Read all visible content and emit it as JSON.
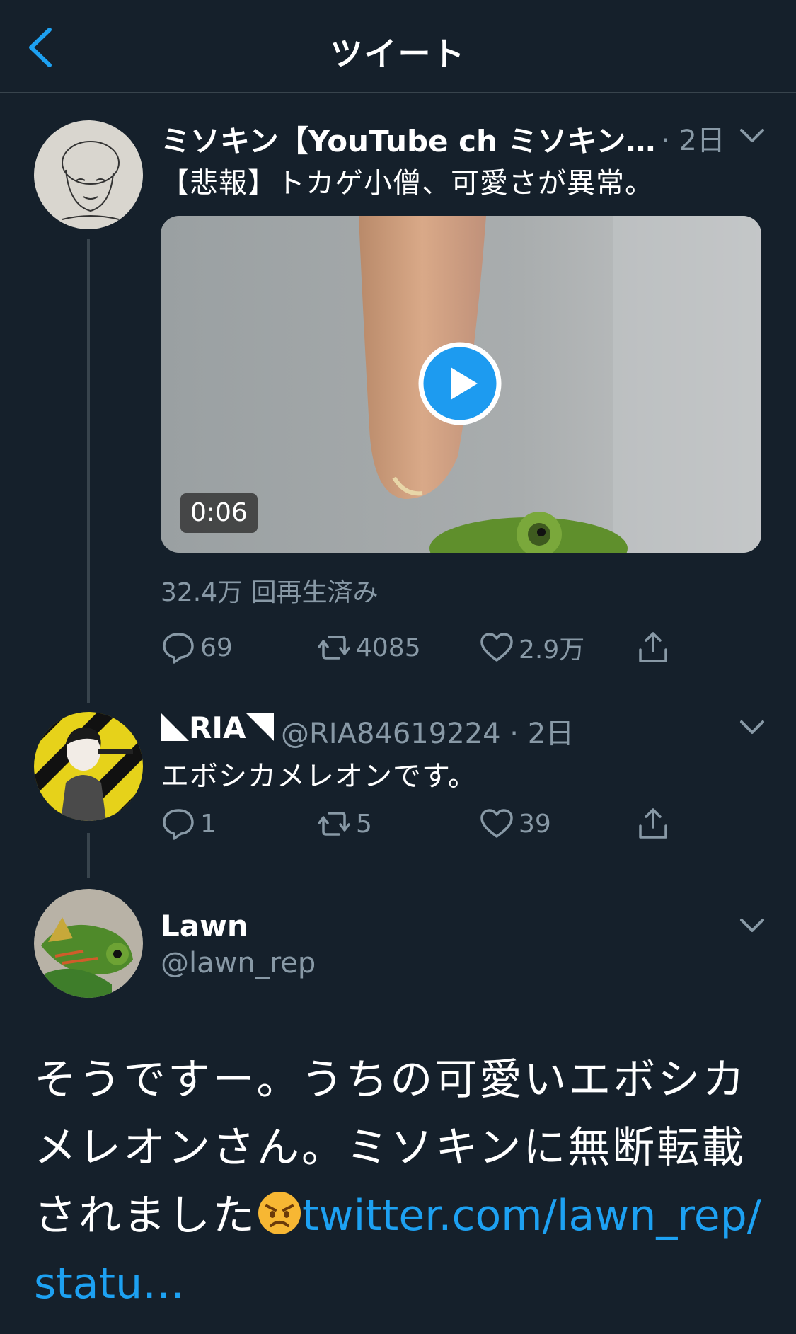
{
  "header": {
    "title": "ツイート"
  },
  "tweets": [
    {
      "display_name": "ミソキン【YouTube ch ミソキン…",
      "meta": "· 2日",
      "text": "【悲報】トカゲ小僧、可愛さが異常。",
      "video": {
        "duration": "0:06",
        "views": "32.4万 回再生済み"
      },
      "actions": {
        "replies": "69",
        "retweets": "4085",
        "likes": "2.9万"
      }
    },
    {
      "display_name": "RIA",
      "handle_meta": "@RIA84619224 · 2日",
      "text": "エボシカメレオンです。",
      "actions": {
        "replies": "1",
        "retweets": "5",
        "likes": "39"
      }
    },
    {
      "display_name": "Lawn",
      "handle": "@lawn_rep",
      "text_lines": [
        "そうですー。うちの可愛いエボシカ",
        "メレオンさん。ミソキンに無断転載",
        "されました"
      ],
      "link_line1": "twitter.com/lawn_rep/",
      "link_line2": "statu…",
      "emoji": "angry-face"
    }
  ],
  "colors": {
    "background": "#15202b",
    "accent": "#1da1f2",
    "muted": "#8899a6",
    "divider": "#38444d"
  }
}
